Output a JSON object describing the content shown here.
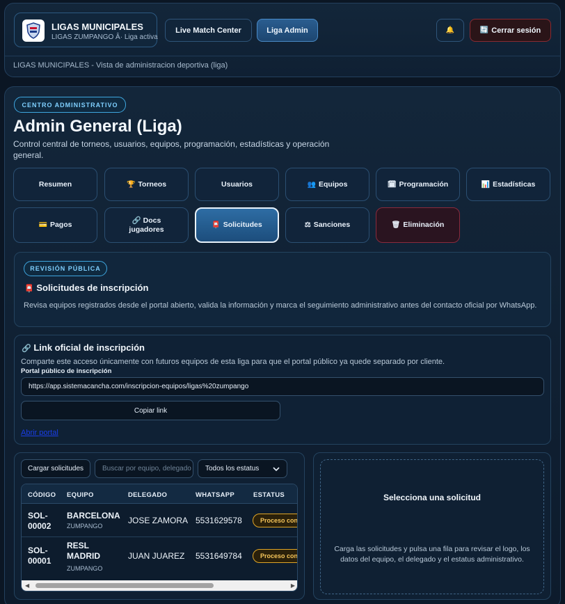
{
  "header": {
    "brand_name": "LIGAS MUNICIPALES",
    "brand_sub": "LIGAS ZUMPANGO Â· Liga activa",
    "nav_live": "Live Match Center",
    "nav_admin": "Liga Admin",
    "bell_icon": "🔔",
    "logout_label": "Cerrar sesión",
    "logout_icon": "🔄",
    "breadcrumb": "LIGAS MUNICIPALES - Vista de administracion deportiva (liga)"
  },
  "main": {
    "pill": "CENTRO ADMINISTRATIVO",
    "title": "Admin General (Liga)",
    "description": "Control central de torneos, usuarios, equipos, programación, estadísticas y operación general."
  },
  "tabs": [
    {
      "icon": "",
      "label": "Resumen"
    },
    {
      "icon": "🏆",
      "label": "Torneos"
    },
    {
      "icon": "",
      "label": "Usuarios"
    },
    {
      "icon": "👥",
      "label": "Equipos"
    },
    {
      "icon": "🗓",
      "label": "Programación"
    },
    {
      "icon": "📊",
      "label": "Estadísticas"
    },
    {
      "icon": "💳",
      "label": "Pagos"
    },
    {
      "icon": "🔗",
      "label": "Docs jugadores"
    },
    {
      "icon": "📮",
      "label": "Solicitudes"
    },
    {
      "icon": "⚖",
      "label": "Sanciones"
    },
    {
      "icon": "🗑",
      "label": "Eliminación"
    }
  ],
  "review": {
    "pill": "REVISIÓN PÚBLICA",
    "icon": "📮",
    "title": "Solicitudes de inscripción",
    "text": "Revisa equipos registrados desde el portal abierto, valida la información y marca el seguimiento administrativo antes del contacto oficial por WhatsApp."
  },
  "link_card": {
    "icon": "🔗",
    "title": "Link oficial de inscripción",
    "text": "Comparte este acceso únicamente con futuros equipos de esta liga para que el portal público ya quede separado por cliente.",
    "field_label": "Portal público de inscripción",
    "url": "https://app.sistemacancha.com/inscripcion-equipos/ligas%20zumpango",
    "copy_label": "Copiar link",
    "open_label": "Abrir portal"
  },
  "list": {
    "load_label": "Cargar solicitudes",
    "search_placeholder": "Buscar por equipo, delegado",
    "status_filter": "Todos los estatus",
    "columns": [
      "CÓDIGO",
      "EQUIPO",
      "DELEGADO",
      "WHATSAPP",
      "ESTATUS"
    ],
    "rows": [
      {
        "code": "SOL-00002",
        "team": "BARCELONA",
        "city": "ZUMPANGO",
        "delegate": "JOSE ZAMORA",
        "whatsapp": "5531629578",
        "status": "Proceso con"
      },
      {
        "code": "SOL-00001",
        "team": "RESL MADRID",
        "city": "ZUMPANGO",
        "delegate": "JUAN JUAREZ",
        "whatsapp": "5531649784",
        "status": "Proceso con"
      }
    ]
  },
  "detail": {
    "title": "Selecciona una solicitud",
    "text": "Carga las solicitudes y pulsa una fila para revisar el logo, los datos del equipo, el delegado y el estatus administrativo."
  }
}
